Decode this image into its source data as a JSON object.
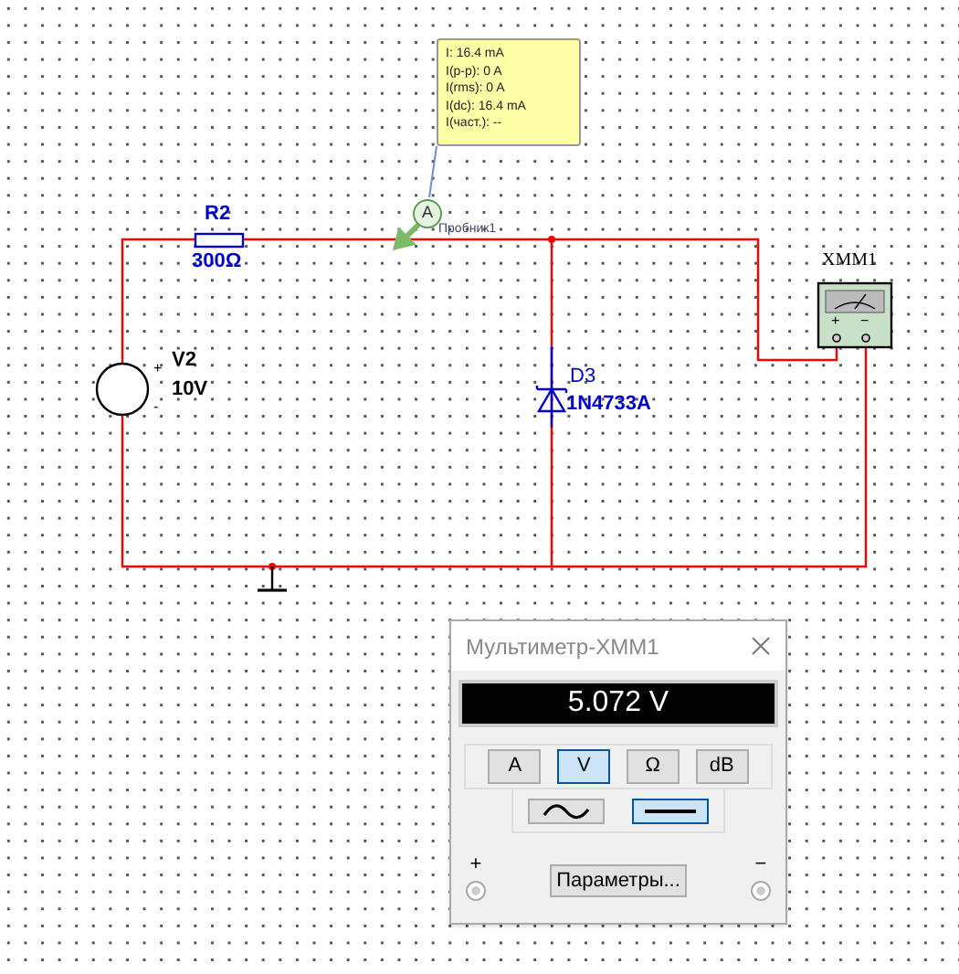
{
  "probe": {
    "readings": [
      "I: 16.4 mA",
      "I(p-p): 0 A",
      "I(rms): 0 A",
      "I(dc): 16.4 mA",
      "I(част.): --"
    ],
    "symbol": "A",
    "label": "Пробник1"
  },
  "components": [
    {
      "kind": "resistor",
      "name": "R2",
      "value": "300Ω"
    },
    {
      "kind": "source",
      "name": "V2",
      "value": "10V",
      "plus": "+",
      "minus": "-"
    },
    {
      "kind": "zener",
      "name": "D3",
      "value": "1N4733A"
    },
    {
      "kind": "meter",
      "name": "XMM1",
      "plus": "+",
      "minus": "−"
    }
  ],
  "multimeter": {
    "title": "Мультиметр-XMM1",
    "display": "5.072 V",
    "modes": [
      {
        "label": "A",
        "selected": false
      },
      {
        "label": "V",
        "selected": true
      },
      {
        "label": "Ω",
        "selected": false
      },
      {
        "label": "dB",
        "selected": false
      }
    ],
    "signals": [
      {
        "kind": "ac",
        "selected": false
      },
      {
        "kind": "dc",
        "selected": true
      }
    ],
    "settings_button": "Параметры...",
    "plus": "+",
    "minus": "−"
  }
}
